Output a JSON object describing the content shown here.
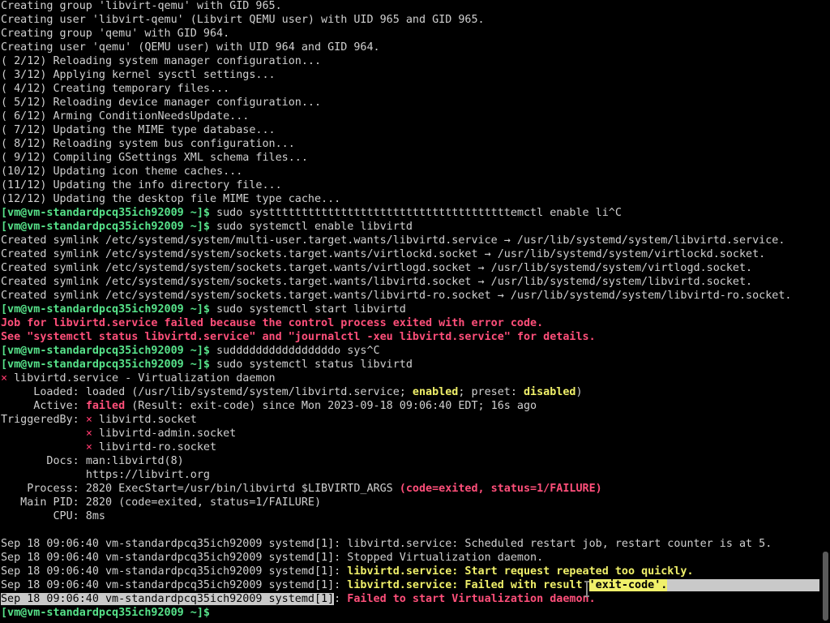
{
  "prompt": {
    "user_host": "[vm@vm-standardpcq35ich92009 ~]$",
    "final_prompt": "[vm@vm-standardpcq35ich92009 ~]$"
  },
  "output": {
    "l1": "Creating group 'libvirt-qemu' with GID 965.",
    "l2": "Creating user 'libvirt-qemu' (Libvirt QEMU user) with UID 965 and GID 965.",
    "l3": "Creating group 'qemu' with GID 964.",
    "l4": "Creating user 'qemu' (QEMU user) with UID 964 and GID 964.",
    "l5": "( 2/12) Reloading system manager configuration...",
    "l6": "( 3/12) Applying kernel sysctl settings...",
    "l7": "( 4/12) Creating temporary files...",
    "l8": "( 5/12) Reloading device manager configuration...",
    "l9": "( 6/12) Arming ConditionNeedsUpdate...",
    "l10": "( 7/12) Updating the MIME type database...",
    "l11": "( 8/12) Reloading system bus configuration...",
    "l12": "( 9/12) Compiling GSettings XML schema files...",
    "l13": "(10/12) Updating icon theme caches...",
    "l14": "(11/12) Updating the info directory file...",
    "l15": "(12/12) Updating the desktop file MIME type cache...",
    "cmd1": " sudo systttttttttttttttttttttttttttttttttttttemctl enable li^C",
    "cmd2": " sudo systemctl enable libvirtd",
    "sym1": "Created symlink /etc/systemd/system/multi-user.target.wants/libvirtd.service → /usr/lib/systemd/system/libvirtd.service.",
    "sym2": "Created symlink /etc/systemd/system/sockets.target.wants/virtlockd.socket → /usr/lib/systemd/system/virtlockd.socket.",
    "sym3": "Created symlink /etc/systemd/system/sockets.target.wants/virtlogd.socket → /usr/lib/systemd/system/virtlogd.socket.",
    "sym4": "Created symlink /etc/systemd/system/sockets.target.wants/libvirtd.socket → /usr/lib/systemd/system/libvirtd.socket.",
    "sym5": "Created symlink /etc/systemd/system/sockets.target.wants/libvirtd-ro.socket → /usr/lib/systemd/system/libvirtd-ro.socket.",
    "cmd3": " sudo systemctl start libvirtd",
    "err1": "Job for libvirtd.service failed because the control process exited with error code.",
    "err2": "See \"systemctl status libvirtd.service\" and \"journalctl -xeu libvirtd.service\" for details.",
    "cmd4": " suddddddddddddddddo sys^C",
    "cmd5": " sudo systemctl status libvirtd",
    "st_x": "×",
    "st_title": " libvirtd.service - Virtualization daemon",
    "loaded_label": "     Loaded: ",
    "loaded_pre": "loaded (/usr/lib/systemd/system/libvirtd.service; ",
    "loaded_enabled": "enabled",
    "loaded_mid": "; preset: ",
    "loaded_disabled": "disabled",
    "loaded_post": ")",
    "active_label": "     Active: ",
    "active_failed": "failed",
    "active_rest": " (Result: exit-code) since Mon 2023-09-18 09:06:40 EDT; 16s ago",
    "trig_label": "TriggeredBy: ",
    "trig1": " libvirtd.socket",
    "trig_indent": "             ",
    "trig2": " libvirtd-admin.socket",
    "trig3": " libvirtd-ro.socket",
    "docs_label": "       Docs: ",
    "docs1": "man:libvirtd(8)",
    "docs2": "https://libvirt.org",
    "proc_label": "    Process: ",
    "proc_main": "2820 ExecStart=/usr/bin/libvirtd $LIBVIRTD_ARGS ",
    "proc_fail": "(code=exited, status=1/FAILURE)",
    "mainpid": "   Main PID: 2820 (code=exited, status=1/FAILURE)",
    "cpu": "        CPU: 8ms",
    "log_prefix": "Sep 18 09:06:40 vm-standardpcq35ich92009 systemd[1]: ",
    "log_prefix_sel": "Sep 18 09:06:40 vm-standardpcq35ich92009 systemd[1]",
    "log_colon": ": ",
    "log1": "libvirtd.service: Scheduled restart job, restart counter is at 5.",
    "log2": "Stopped Virtualization daemon.",
    "log3": "libvirtd.service: Start request repeated too quickly.",
    "log4a": "libvirtd.service: Failed with result ",
    "log4b": "'exit-code'",
    "log4c": ".",
    "log5": "Failed to start Virtualization daemon."
  },
  "colors": {
    "background": "#000000",
    "prompt_green": "#57e38a",
    "error_red": "#ff3a6e",
    "warn_yellow": "#f0f06a",
    "selection_gray": "#c9c9c9"
  }
}
